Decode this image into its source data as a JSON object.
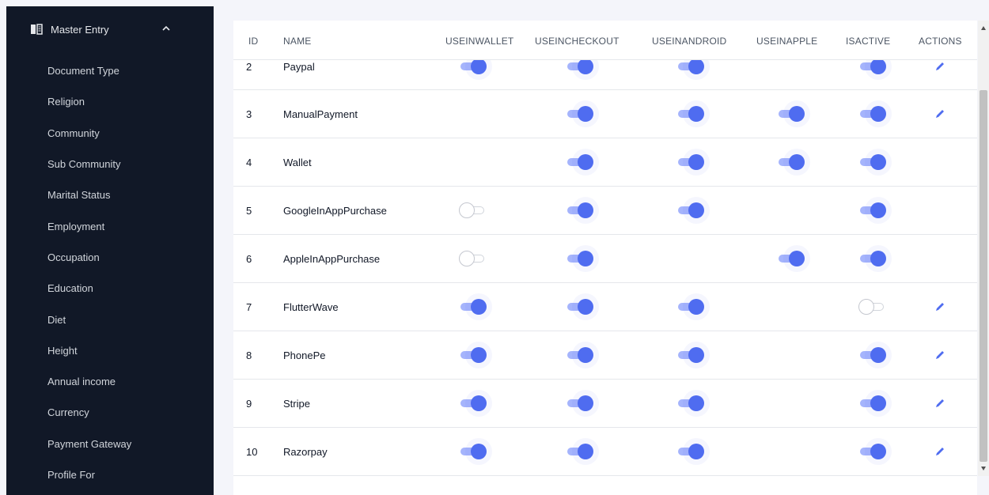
{
  "sidebar": {
    "section_title": "Master Entry",
    "section_icon": "book-icon",
    "items": [
      {
        "label": "Document Type"
      },
      {
        "label": "Religion"
      },
      {
        "label": "Community"
      },
      {
        "label": "Sub Community"
      },
      {
        "label": "Marital Status"
      },
      {
        "label": "Employment"
      },
      {
        "label": "Occupation"
      },
      {
        "label": "Education"
      },
      {
        "label": "Diet"
      },
      {
        "label": "Height"
      },
      {
        "label": "Annual income"
      },
      {
        "label": "Currency"
      },
      {
        "label": "Payment Gateway"
      },
      {
        "label": "Profile For"
      }
    ]
  },
  "table": {
    "columns": [
      "ID",
      "NAME",
      "USEINWALLET",
      "USEINCHECKOUT",
      "USEINANDROID",
      "USEINAPPLE",
      "ISACTIVE",
      "ACTIONS"
    ],
    "rows": [
      {
        "id": "2",
        "name": "Paypal",
        "wallet": true,
        "checkout": true,
        "android": true,
        "apple": null,
        "active": true,
        "edit": true
      },
      {
        "id": "3",
        "name": "ManualPayment",
        "wallet": null,
        "checkout": true,
        "android": true,
        "apple": true,
        "active": true,
        "edit": true
      },
      {
        "id": "4",
        "name": "Wallet",
        "wallet": null,
        "checkout": true,
        "android": true,
        "apple": true,
        "active": true,
        "edit": false
      },
      {
        "id": "5",
        "name": "GoogleInAppPurchase",
        "wallet": false,
        "checkout": true,
        "android": true,
        "apple": null,
        "active": true,
        "edit": false
      },
      {
        "id": "6",
        "name": "AppleInAppPurchase",
        "wallet": false,
        "checkout": true,
        "android": null,
        "apple": true,
        "active": true,
        "edit": false
      },
      {
        "id": "7",
        "name": "FlutterWave",
        "wallet": true,
        "checkout": true,
        "android": true,
        "apple": null,
        "active": false,
        "edit": true
      },
      {
        "id": "8",
        "name": "PhonePe",
        "wallet": true,
        "checkout": true,
        "android": true,
        "apple": null,
        "active": true,
        "edit": true
      },
      {
        "id": "9",
        "name": "Stripe",
        "wallet": true,
        "checkout": true,
        "android": true,
        "apple": null,
        "active": true,
        "edit": true
      },
      {
        "id": "10",
        "name": "Razorpay",
        "wallet": true,
        "checkout": true,
        "android": true,
        "apple": null,
        "active": true,
        "edit": true
      }
    ]
  },
  "colors": {
    "sidebar_bg": "#111827",
    "toggle_on": "#4f6cf0",
    "toggle_track_on": "#a5b4fc",
    "edit_icon": "#4f6cf0"
  }
}
